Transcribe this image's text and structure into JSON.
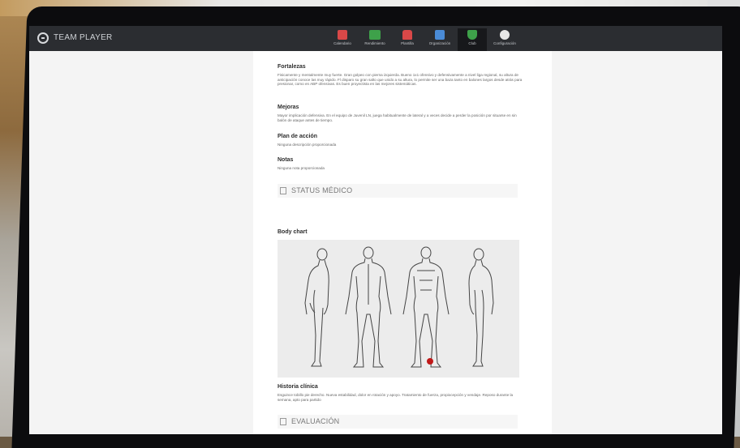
{
  "app": {
    "brand": "TEAM PLAYER"
  },
  "nav": {
    "items": [
      {
        "label": "Calendario",
        "icon": "calendar-icon",
        "color": "#d94848"
      },
      {
        "label": "Rendimiento",
        "icon": "chart-icon",
        "color": "#3ea14a"
      },
      {
        "label": "Plantilla",
        "icon": "shirt-icon",
        "color": "#d94848"
      },
      {
        "label": "Organización",
        "icon": "building-icon",
        "color": "#4a8bd6"
      },
      {
        "label": "Club",
        "icon": "shield-icon",
        "color": "#3ea14a"
      },
      {
        "label": "Configuración",
        "icon": "gear-icon",
        "color": "#e6e6e6"
      }
    ],
    "active_index": 4
  },
  "report": {
    "fortalezas": {
      "title": "Fortalezas",
      "text": "Fisicamente y mentalmente muy fuerte. Gran golpeo con pierna izquierda. Bueno 1x1 ofensivo y defensivamente a nivel liga regional, su altura de anticipación conoce las muy rápido. Fl disparo su gran salto que unido a su altura, lo permite ser una baza tanto en balones largos desde atrás para presionar, como en ABP ofensivas. Es buen proyectista en las mejores sistemáticas."
    },
    "mejoras": {
      "title": "Mejoras",
      "text": "Mayor implicación defensiva. En el equipo de Juvenil LN, juega habitualmente de lateral y a veces decide a perder la posición por situarse en sin balón de ataque antes de tiempo."
    },
    "plan": {
      "title": "Plan de acción",
      "text": "Ninguna descripción proporcionada"
    },
    "notas": {
      "title": "Notas",
      "text": "Ninguna nota proporcionada"
    },
    "status_header": "STATUS MÉDICO",
    "body_chart_title": "Body chart",
    "historia": {
      "title": "Historia clínica",
      "text": "Esguince tobillo pie derecho. Nueva estabilidad, dolor en rotación y apoyo. Tratamiento de fuerza, propiocepción y vendaje. Reposo durante la semana, apto para partido"
    },
    "evaluacion_header": "EVALUACIÓN"
  },
  "body_chart": {
    "injury_marker_color": "#c01818",
    "injury_location": "right ankle"
  }
}
